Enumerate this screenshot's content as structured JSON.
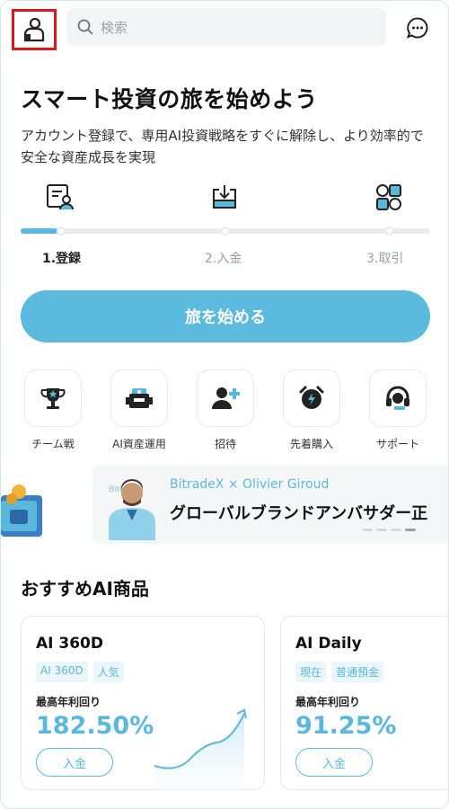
{
  "header": {
    "search_placeholder": "検索"
  },
  "hero": {
    "title": "スマート投資の旅を始めよう",
    "subtitle": "アカウント登録で、専用AI投資戦略をすぐに解除し、より効率的で安全な資産成長を実現"
  },
  "steps": {
    "progress_fraction": 0.09,
    "items": [
      {
        "label": "1.登録",
        "icon": "register-icon",
        "active": true
      },
      {
        "label": "2.入金",
        "icon": "deposit-icon",
        "active": false
      },
      {
        "label": "3.取引",
        "icon": "trade-icon",
        "active": false
      }
    ]
  },
  "cta": {
    "label": "旅を始める"
  },
  "quick_actions": [
    {
      "label": "チーム戦",
      "icon": "trophy-icon"
    },
    {
      "label": "AI資産運用",
      "icon": "robot-icon"
    },
    {
      "label": "招待",
      "icon": "invite-user-icon"
    },
    {
      "label": "先着購入",
      "icon": "alarm-clock-icon"
    },
    {
      "label": "サポート",
      "icon": "support-headset-icon"
    }
  ],
  "banner": {
    "subtitle": "BitradeX × Olivier Giroud",
    "title": "グローバルブランドアンバサダー正",
    "photo_lettering": "BitradeX",
    "page_count": 4,
    "active_page": 3
  },
  "recommended": {
    "title": "おすすめAI商品",
    "cards": [
      {
        "name": "AI 360D",
        "tags": [
          "AI 360D",
          "人気"
        ],
        "yield_label": "最高年利回り",
        "yield": "182.50%",
        "button": "入金"
      },
      {
        "name": "AI Daily",
        "tags": [
          "現在",
          "普通預金"
        ],
        "yield_label": "最高年利回り",
        "yield": "91.25%",
        "button": "入金"
      }
    ]
  },
  "colors": {
    "accent": "#5cbadf",
    "highlight_border": "#e0141c",
    "tag_bg": "#eaf6fb"
  }
}
